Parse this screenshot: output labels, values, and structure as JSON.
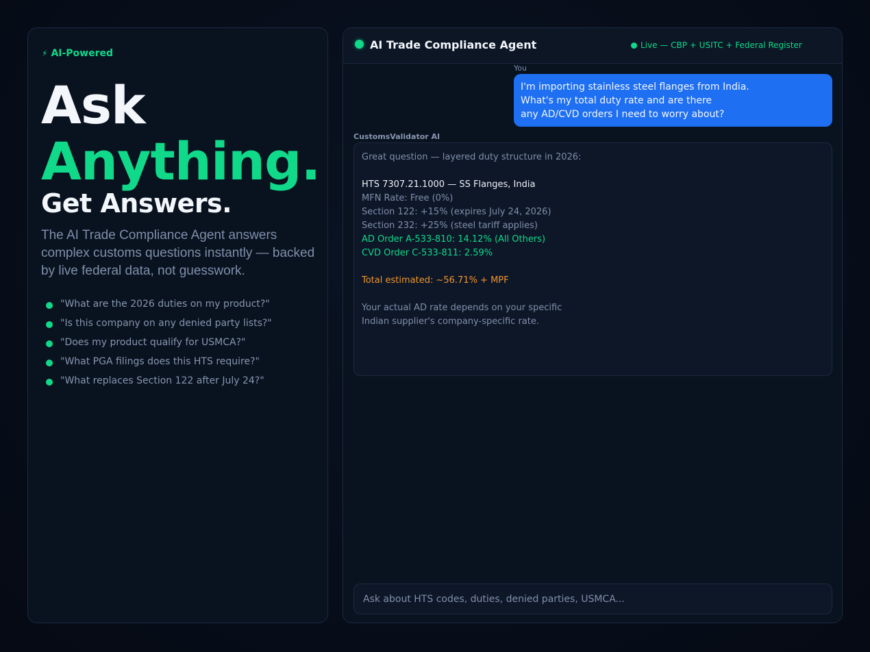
{
  "colors": {
    "accent": "#10d98a",
    "user_bubble": "#1f6ff2",
    "total_highlight": "#f0952a",
    "background": "#060c17"
  },
  "left": {
    "badge_icon": "lightning-bolt-icon",
    "badge_glyph": "⚡",
    "badge": "AI-Powered",
    "hero": {
      "line1": "Ask",
      "line2": "Anything.",
      "line3": "Get Answers."
    },
    "lead": "The AI Trade Compliance Agent answers complex customs questions instantly — backed by live federal data, not guesswork.",
    "examples": [
      "\"What are the 2026 duties on my product?\"",
      "\"Is this company on any denied party lists?\"",
      "\"Does my product qualify for USMCA?\"",
      "\"What PGA filings does this HTS require?\"",
      "\"What replaces Section 122 after July 24?\""
    ]
  },
  "chat": {
    "title": "AI Trade Compliance Agent",
    "status": "Live — CBP + USITC + Federal Register",
    "user": {
      "label": "You",
      "lines": [
        "I'm importing stainless steel flanges from India.",
        "What's my total duty rate and are there",
        "any AD/CVD orders I need to worry about?"
      ]
    },
    "ai": {
      "label": "CustomsValidator AI",
      "intro": "Great question — layered duty structure in 2026:",
      "hts": "HTS 7307.21.1000 — SS Flanges, India",
      "mfn": "MFN Rate: Free (0%)",
      "s122": "Section 122: +15% (expires July 24, 2026)",
      "s232": "Section 232: +25% (steel tariff applies)",
      "ad": "AD Order A-533-810: 14.12% (All Others)",
      "cvd": "CVD Order C-533-811: 2.59%",
      "total": "Total estimated: ~56.71% + MPF",
      "note1": "Your actual AD rate depends on your specific",
      "note2": "Indian supplier's company-specific rate."
    },
    "input_placeholder": "Ask about HTS codes, duties, denied parties, USMCA...",
    "input_value": ""
  }
}
